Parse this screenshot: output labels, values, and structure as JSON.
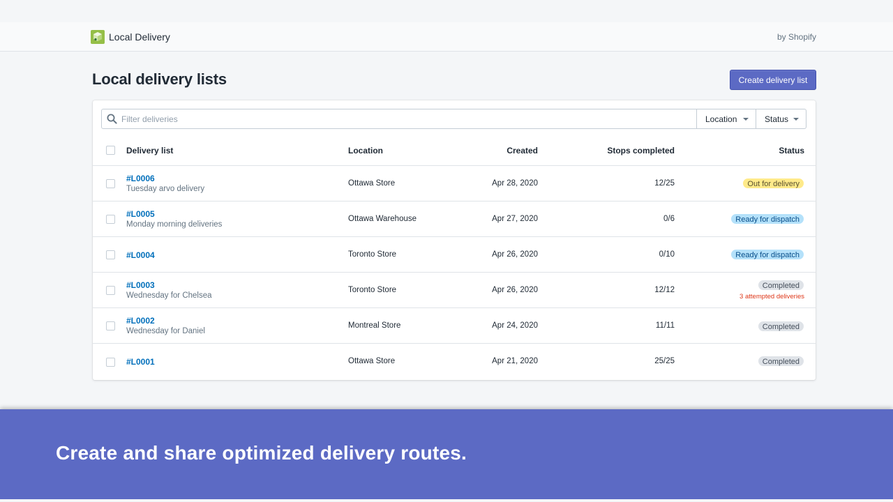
{
  "appbar": {
    "app_name": "Local Delivery",
    "vendor": "by Shopify"
  },
  "page": {
    "title": "Local delivery lists",
    "create_button": "Create delivery list"
  },
  "filters": {
    "placeholder": "Filter deliveries",
    "location_label": "Location",
    "status_label": "Status"
  },
  "table": {
    "headers": {
      "delivery_list": "Delivery list",
      "location": "Location",
      "created": "Created",
      "stops_completed": "Stops completed",
      "status": "Status"
    },
    "rows": [
      {
        "id": "#L0006",
        "name": "Tuesday arvo delivery",
        "location": "Ottawa Store",
        "created": "Apr 28, 2020",
        "stops": "12/25",
        "status": "Out for delivery",
        "note": ""
      },
      {
        "id": "#L0005",
        "name": "Monday morning deliveries",
        "location": "Ottawa Warehouse",
        "created": "Apr 27, 2020",
        "stops": "0/6",
        "status": "Ready for dispatch",
        "note": ""
      },
      {
        "id": "#L0004",
        "name": "",
        "location": "Toronto Store",
        "created": "Apr 26, 2020",
        "stops": "0/10",
        "status": "Ready for dispatch",
        "note": ""
      },
      {
        "id": "#L0003",
        "name": "Wednesday for Chelsea",
        "location": "Toronto Store",
        "created": "Apr 26, 2020",
        "stops": "12/12",
        "status": "Completed",
        "note": "3 attempted deliveries"
      },
      {
        "id": "#L0002",
        "name": "Wednesday for Daniel",
        "location": "Montreal Store",
        "created": "Apr 24, 2020",
        "stops": "11/11",
        "status": "Completed",
        "note": ""
      },
      {
        "id": "#L0001",
        "name": "",
        "location": "Ottawa Store",
        "created": "Apr 21, 2020",
        "stops": "25/25",
        "status": "Completed",
        "note": ""
      }
    ]
  },
  "status_colors": {
    "out_for_delivery": "#ffea8a",
    "ready_for_dispatch": "#b4e1fa",
    "completed": "#dfe3e8",
    "warning_text": "#de3618"
  },
  "accent_color": "#5c6ac4",
  "link_color": "#006fbb",
  "icons": {
    "logo": "local-delivery-logo",
    "search": "search-icon",
    "caret": "caret-down-icon"
  },
  "banner": {
    "headline": "Create and share optimized delivery routes."
  }
}
